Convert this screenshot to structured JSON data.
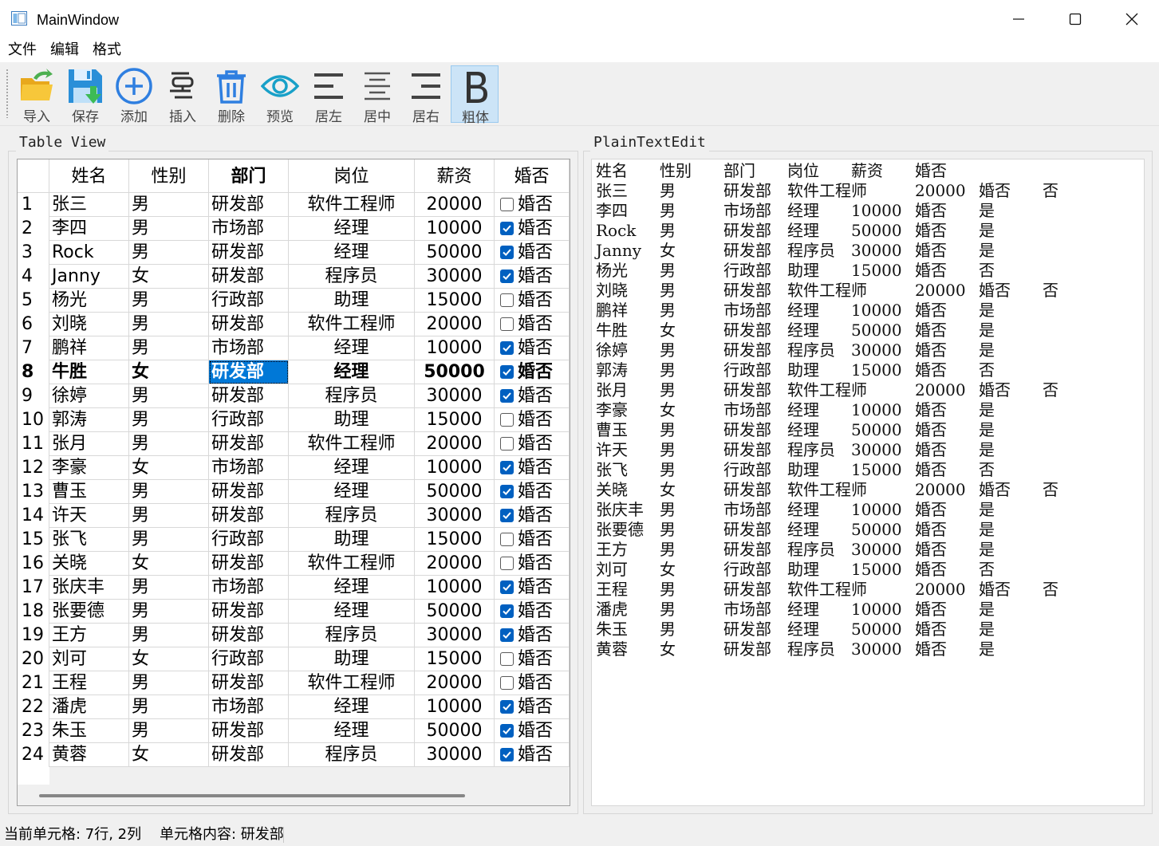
{
  "window": {
    "title": "MainWindow"
  },
  "menu": [
    "文件",
    "编辑",
    "格式"
  ],
  "toolbar": [
    {
      "label": "导入",
      "icon": "folder-open-icon"
    },
    {
      "label": "保存",
      "icon": "save-icon"
    },
    {
      "label": "添加",
      "icon": "add-circle-icon"
    },
    {
      "label": "插入",
      "icon": "insert-icon"
    },
    {
      "label": "删除",
      "icon": "trash-icon"
    },
    {
      "label": "预览",
      "icon": "eye-icon"
    },
    {
      "label": "居左",
      "icon": "align-left-icon"
    },
    {
      "label": "居中",
      "icon": "align-center-icon"
    },
    {
      "label": "居右",
      "icon": "align-right-icon"
    },
    {
      "label": "粗体",
      "icon": "bold-icon",
      "active": true
    }
  ],
  "table_view": {
    "title": "Table View",
    "headers": [
      "姓名",
      "性别",
      "部门",
      "岗位",
      "薪资",
      "婚否"
    ],
    "rows": [
      {
        "name": "张三",
        "gender": "男",
        "dept": "研发部",
        "post": "软件工程师",
        "salary": "20000",
        "married": false,
        "married_label": "婚否"
      },
      {
        "name": "李四",
        "gender": "男",
        "dept": "市场部",
        "post": "经理",
        "salary": "10000",
        "married": true,
        "married_label": "婚否"
      },
      {
        "name": "Rock",
        "gender": "男",
        "dept": "研发部",
        "post": "经理",
        "salary": "50000",
        "married": true,
        "married_label": "婚否"
      },
      {
        "name": "Janny",
        "gender": "女",
        "dept": "研发部",
        "post": "程序员",
        "salary": "30000",
        "married": true,
        "married_label": "婚否"
      },
      {
        "name": "杨光",
        "gender": "男",
        "dept": "行政部",
        "post": "助理",
        "salary": "15000",
        "married": false,
        "married_label": "婚否"
      },
      {
        "name": "刘晓",
        "gender": "男",
        "dept": "研发部",
        "post": "软件工程师",
        "salary": "20000",
        "married": false,
        "married_label": "婚否"
      },
      {
        "name": "鹏祥",
        "gender": "男",
        "dept": "市场部",
        "post": "经理",
        "salary": "10000",
        "married": true,
        "married_label": "婚否"
      },
      {
        "name": "牛胜",
        "gender": "女",
        "dept": "研发部",
        "post": "经理",
        "salary": "50000",
        "married": true,
        "married_label": "婚否",
        "bold": true,
        "selected_col": 2
      },
      {
        "name": "徐婷",
        "gender": "男",
        "dept": "研发部",
        "post": "程序员",
        "salary": "30000",
        "married": true,
        "married_label": "婚否"
      },
      {
        "name": "郭涛",
        "gender": "男",
        "dept": "行政部",
        "post": "助理",
        "salary": "15000",
        "married": false,
        "married_label": "婚否"
      },
      {
        "name": "张月",
        "gender": "男",
        "dept": "研发部",
        "post": "软件工程师",
        "salary": "20000",
        "married": false,
        "married_label": "婚否"
      },
      {
        "name": "李豪",
        "gender": "女",
        "dept": "市场部",
        "post": "经理",
        "salary": "10000",
        "married": true,
        "married_label": "婚否"
      },
      {
        "name": "曹玉",
        "gender": "男",
        "dept": "研发部",
        "post": "经理",
        "salary": "50000",
        "married": true,
        "married_label": "婚否"
      },
      {
        "name": "许天",
        "gender": "男",
        "dept": "研发部",
        "post": "程序员",
        "salary": "30000",
        "married": true,
        "married_label": "婚否"
      },
      {
        "name": "张飞",
        "gender": "男",
        "dept": "行政部",
        "post": "助理",
        "salary": "15000",
        "married": false,
        "married_label": "婚否"
      },
      {
        "name": "关晓",
        "gender": "女",
        "dept": "研发部",
        "post": "软件工程师",
        "salary": "20000",
        "married": false,
        "married_label": "婚否"
      },
      {
        "name": "张庆丰",
        "gender": "男",
        "dept": "市场部",
        "post": "经理",
        "salary": "10000",
        "married": true,
        "married_label": "婚否"
      },
      {
        "name": "张要德",
        "gender": "男",
        "dept": "研发部",
        "post": "经理",
        "salary": "50000",
        "married": true,
        "married_label": "婚否"
      },
      {
        "name": "王方",
        "gender": "男",
        "dept": "研发部",
        "post": "程序员",
        "salary": "30000",
        "married": true,
        "married_label": "婚否"
      },
      {
        "name": "刘可",
        "gender": "女",
        "dept": "行政部",
        "post": "助理",
        "salary": "15000",
        "married": false,
        "married_label": "婚否"
      },
      {
        "name": "王程",
        "gender": "男",
        "dept": "研发部",
        "post": "软件工程师",
        "salary": "20000",
        "married": false,
        "married_label": "婚否"
      },
      {
        "name": "潘虎",
        "gender": "男",
        "dept": "市场部",
        "post": "经理",
        "salary": "10000",
        "married": true,
        "married_label": "婚否"
      },
      {
        "name": "朱玉",
        "gender": "男",
        "dept": "研发部",
        "post": "经理",
        "salary": "50000",
        "married": true,
        "married_label": "婚否"
      },
      {
        "name": "黄蓉",
        "gender": "女",
        "dept": "研发部",
        "post": "程序员",
        "salary": "30000",
        "married": true,
        "married_label": "婚否"
      }
    ]
  },
  "plain_text_edit": {
    "title": "PlainTextEdit",
    "lines": [
      [
        "姓名",
        "性别",
        "部门",
        "岗位",
        "薪资",
        "婚否"
      ],
      [
        "张三",
        "男",
        "研发部",
        "软件工程师",
        "20000",
        "婚否",
        "否"
      ],
      [
        "李四",
        "男",
        "市场部",
        "经理",
        "10000",
        "婚否",
        "是"
      ],
      [
        "Rock",
        "男",
        "研发部",
        "经理",
        "50000",
        "婚否",
        "是"
      ],
      [
        "Janny",
        "女",
        "研发部",
        "程序员",
        "30000",
        "婚否",
        "是"
      ],
      [
        "杨光",
        "男",
        "行政部",
        "助理",
        "15000",
        "婚否",
        "否"
      ],
      [
        "刘晓",
        "男",
        "研发部",
        "软件工程师",
        "20000",
        "婚否",
        "否"
      ],
      [
        "鹏祥",
        "男",
        "市场部",
        "经理",
        "10000",
        "婚否",
        "是"
      ],
      [
        "牛胜",
        "女",
        "研发部",
        "经理",
        "50000",
        "婚否",
        "是"
      ],
      [
        "徐婷",
        "男",
        "研发部",
        "程序员",
        "30000",
        "婚否",
        "是"
      ],
      [
        "郭涛",
        "男",
        "行政部",
        "助理",
        "15000",
        "婚否",
        "否"
      ],
      [
        "张月",
        "男",
        "研发部",
        "软件工程师",
        "20000",
        "婚否",
        "否"
      ],
      [
        "李豪",
        "女",
        "市场部",
        "经理",
        "10000",
        "婚否",
        "是"
      ],
      [
        "曹玉",
        "男",
        "研发部",
        "经理",
        "50000",
        "婚否",
        "是"
      ],
      [
        "许天",
        "男",
        "研发部",
        "程序员",
        "30000",
        "婚否",
        "是"
      ],
      [
        "张飞",
        "男",
        "行政部",
        "助理",
        "15000",
        "婚否",
        "否"
      ],
      [
        "关晓",
        "女",
        "研发部",
        "软件工程师",
        "20000",
        "婚否",
        "否"
      ],
      [
        "张庆丰",
        "男",
        "市场部",
        "经理",
        "10000",
        "婚否",
        "是"
      ],
      [
        "张要德",
        "男",
        "研发部",
        "经理",
        "50000",
        "婚否",
        "是"
      ],
      [
        "王方",
        "男",
        "研发部",
        "程序员",
        "30000",
        "婚否",
        "是"
      ],
      [
        "刘可",
        "女",
        "行政部",
        "助理",
        "15000",
        "婚否",
        "否"
      ],
      [
        "王程",
        "男",
        "研发部",
        "软件工程师",
        "20000",
        "婚否",
        "否"
      ],
      [
        "潘虎",
        "男",
        "市场部",
        "经理",
        "10000",
        "婚否",
        "是"
      ],
      [
        "朱玉",
        "男",
        "研发部",
        "经理",
        "50000",
        "婚否",
        "是"
      ],
      [
        "黄蓉",
        "女",
        "研发部",
        "程序员",
        "30000",
        "婚否",
        "是"
      ]
    ]
  },
  "statusbar": {
    "current_cell": "当前单元格: 7行, 2列",
    "cell_content": "单元格内容: 研发部"
  }
}
